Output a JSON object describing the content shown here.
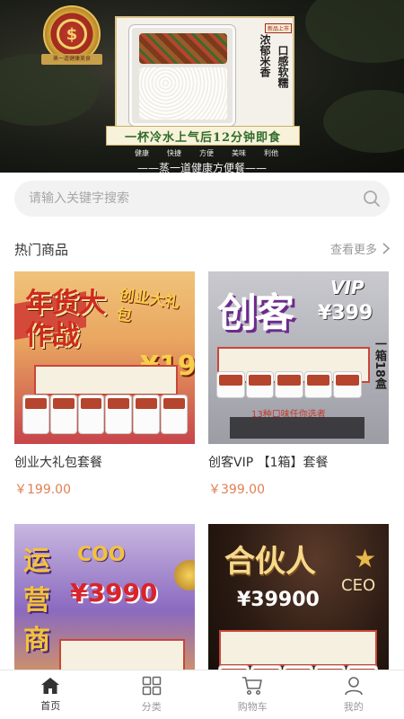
{
  "banner": {
    "logo_text": "蒸一道健康美食",
    "tag_small": "新品上市",
    "tags": [
      "浓郁米香",
      "口感软糯"
    ],
    "slogan": "一杯冷水上气后12分钟即食",
    "features": [
      "健康",
      "快捷",
      "方便",
      "美味",
      "利他"
    ],
    "tagline": "——蒸一道健康方便餐——"
  },
  "search": {
    "placeholder": "请输入关键字搜索"
  },
  "section": {
    "title": "热门商品",
    "more": "查看更多"
  },
  "products": [
    {
      "name": "创业大礼包套餐",
      "price": "￥199.00",
      "poster": {
        "big": "年货大作战",
        "gift": "创业大礼包",
        "num": "¥199"
      }
    },
    {
      "name": "创客VIP 【1箱】套餐",
      "price": "￥399.00",
      "poster": {
        "big": "创客",
        "vip": "VIP",
        "price": "¥399",
        "side": "一箱18盒",
        "flavors": "13种口味任你选者"
      }
    },
    {
      "name": "",
      "price": "",
      "poster": {
        "big": "运营商",
        "coo": "COO",
        "price": "¥3990"
      }
    },
    {
      "name": "",
      "price": "",
      "poster": {
        "big": "合伙人",
        "ceo": "CEO",
        "price": "¥39900"
      }
    }
  ],
  "tabbar": [
    {
      "label": "首页",
      "icon": "home-icon",
      "active": true
    },
    {
      "label": "分类",
      "icon": "grid-icon",
      "active": false
    },
    {
      "label": "购物车",
      "icon": "cart-icon",
      "active": false
    },
    {
      "label": "我的",
      "icon": "user-icon",
      "active": false
    }
  ],
  "colors": {
    "price": "#e08055",
    "tab_active": "#333333",
    "tab_inactive": "#999999",
    "search_bg": "#f2f2f2"
  }
}
